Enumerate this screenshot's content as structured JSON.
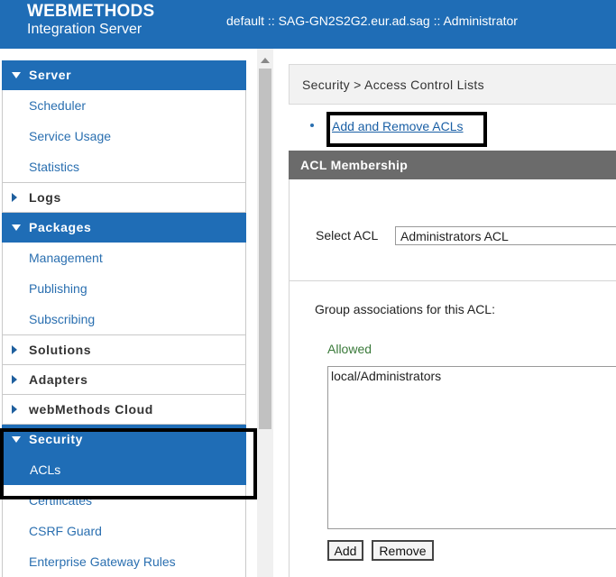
{
  "header": {
    "brand_top": "WEBMETHODS",
    "brand_bottom": "Integration Server",
    "server_info": "default :: SAG-GN2S2G2.eur.ad.sag :: Administrator",
    "background_color": "#1f6db6"
  },
  "sidebar": {
    "server": {
      "label": "Server",
      "state": "expanded",
      "items": [
        "Scheduler",
        "Service Usage",
        "Statistics"
      ]
    },
    "logs": {
      "label": "Logs",
      "state": "collapsed"
    },
    "packages": {
      "label": "Packages",
      "state": "expanded",
      "items": [
        "Management",
        "Publishing",
        "Subscribing"
      ]
    },
    "solutions": {
      "label": "Solutions",
      "state": "collapsed"
    },
    "adapters": {
      "label": "Adapters",
      "state": "collapsed"
    },
    "cloud": {
      "label": "webMethods Cloud",
      "state": "collapsed"
    },
    "security": {
      "label": "Security",
      "state": "expanded",
      "active_item": "ACLs",
      "items": [
        "ACLs",
        "Certificates",
        "CSRF Guard",
        "Enterprise Gateway Rules"
      ]
    }
  },
  "main": {
    "breadcrumb": "Security > Access Control Lists",
    "link": "Add and Remove ACLs",
    "panel_title": "ACL Membership",
    "select_label": "Select ACL",
    "select_value": "Administrators ACL",
    "group_label": "Group associations for this ACL:",
    "allowed_label": "Allowed",
    "allowed_items": [
      "local/Administrators"
    ],
    "add_button": "Add",
    "remove_button": "Remove"
  },
  "icons": {
    "expanded": "triangle-down-icon",
    "collapsed": "triangle-right-icon"
  }
}
